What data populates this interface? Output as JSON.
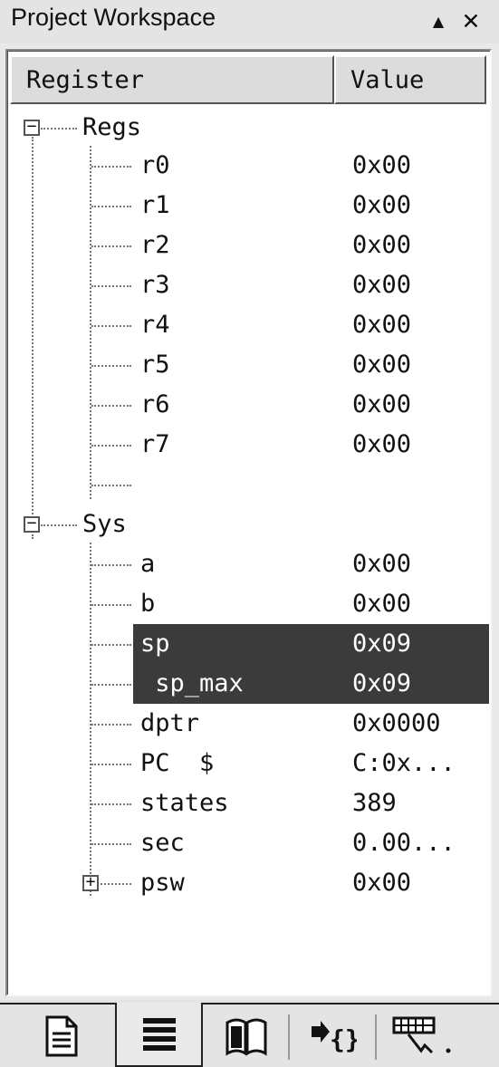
{
  "window": {
    "title": "Project Workspace",
    "pin_glyph": "▲",
    "close_glyph": "✕"
  },
  "columns": {
    "register": "Register",
    "value": "Value"
  },
  "groups": [
    {
      "label": "Regs",
      "expander": "−",
      "rows": [
        {
          "name": "r0",
          "value": "0x00"
        },
        {
          "name": "r1",
          "value": "0x00"
        },
        {
          "name": "r2",
          "value": "0x00"
        },
        {
          "name": "r3",
          "value": "0x00"
        },
        {
          "name": "r4",
          "value": "0x00"
        },
        {
          "name": "r5",
          "value": "0x00"
        },
        {
          "name": "r6",
          "value": "0x00"
        },
        {
          "name": "r7",
          "value": "0x00"
        }
      ]
    },
    {
      "label": "Sys",
      "expander": "−",
      "rows": [
        {
          "name": "a",
          "value": "0x00"
        },
        {
          "name": "b",
          "value": "0x00"
        },
        {
          "name": "sp",
          "value": "0x09"
        },
        {
          "name": " sp_max",
          "value": "0x09"
        },
        {
          "name": "dptr",
          "value": "0x0000"
        },
        {
          "name": "PC  $",
          "value": "C:0x..."
        },
        {
          "name": "states",
          "value": "389"
        },
        {
          "name": "sec",
          "value": "0.00..."
        },
        {
          "name": "psw",
          "value": "0x00",
          "expander": "+"
        }
      ]
    }
  ],
  "tabs": [
    {
      "icon": "files-icon",
      "active": false
    },
    {
      "icon": "registers-icon",
      "active": true
    },
    {
      "icon": "books-icon",
      "active": false
    },
    {
      "icon": "functions-icon",
      "active": false
    },
    {
      "icon": "templates-icon",
      "active": false
    }
  ],
  "colors": {
    "selection": "#3b3b3b",
    "selection_text": "#ffffff"
  }
}
